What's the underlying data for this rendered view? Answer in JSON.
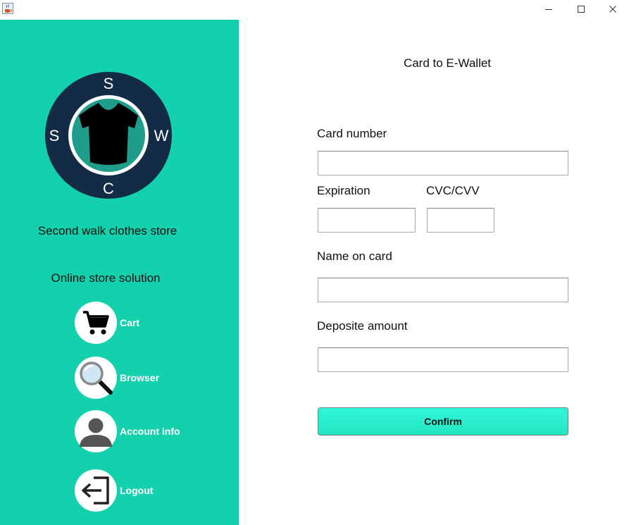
{
  "window": {
    "app_icon": "java-coffee-icon",
    "minimize_glyph": "—",
    "maximize_glyph": "☐",
    "close_glyph": "✕"
  },
  "sidebar": {
    "background": "#13d1ad",
    "logo": {
      "letters": {
        "top": "S",
        "left": "S",
        "right": "W",
        "bottom": "C"
      },
      "icon": "shirt-icon"
    },
    "store_name": "Second walk clothes store",
    "store_tagline": "Online store solution",
    "nav": [
      {
        "label": "Cart",
        "icon": "cart-icon"
      },
      {
        "label": "Browser",
        "icon": "magnifier-icon"
      },
      {
        "label": "Account info",
        "icon": "user-icon"
      },
      {
        "label": "Logout",
        "icon": "logout-icon"
      }
    ]
  },
  "form": {
    "title": "Card to E-Wallet",
    "card_number": {
      "label": "Card number",
      "value": ""
    },
    "expiration": {
      "label": "Expiration",
      "value": ""
    },
    "cvc": {
      "label": "CVC/CVV",
      "value": ""
    },
    "name_on_card": {
      "label": "Name on card",
      "value": ""
    },
    "deposit_amount": {
      "label": "Deposite amount",
      "value": ""
    },
    "confirm_label": "Confirm",
    "confirm_color": "#2ef5d3"
  }
}
